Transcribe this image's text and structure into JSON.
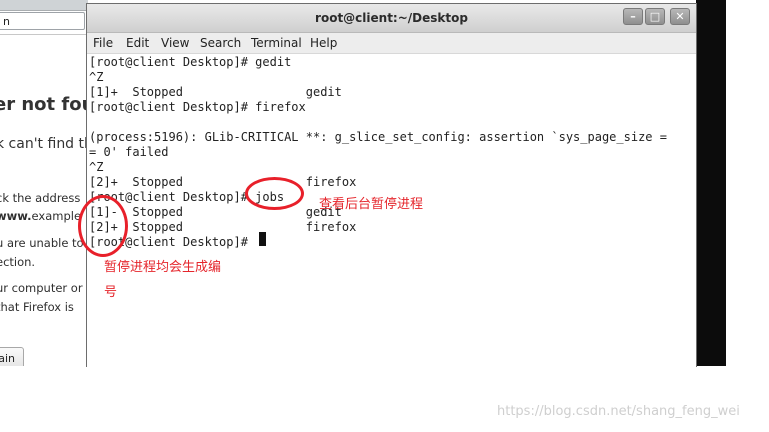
{
  "background_browser": {
    "url_partial": "n",
    "heading_partial": "er not fou",
    "subheading_partial": "k can't find th",
    "line1": "ck the address",
    "line2_prefix": "www.",
    "line2_rest": "example",
    "line3": "u are unable to",
    "line4": "ection.",
    "line5": "ur computer or",
    "line6": " that Firefox is",
    "try_button_partial": "ain"
  },
  "terminal": {
    "title": "root@client:~/Desktop",
    "window_buttons": {
      "minimize": "–",
      "maximize": "□",
      "close": "✕"
    },
    "menu": [
      "File",
      "Edit",
      "View",
      "Search",
      "Terminal",
      "Help"
    ],
    "lines": [
      "[root@client Desktop]# gedit",
      "^Z",
      "[1]+  Stopped                 gedit",
      "[root@client Desktop]# firefox",
      "",
      "(process:5196): GLib-CRITICAL **: g_slice_set_config: assertion `sys_page_size =",
      "= 0' failed",
      "^Z",
      "[2]+  Stopped                 firefox",
      "[root@client Desktop]# jobs",
      "[1]-  Stopped                 gedit",
      "[2]+  Stopped                 firefox",
      "[root@client Desktop]# "
    ]
  },
  "annotations": {
    "jobs_note": "查看后台暂停进程",
    "numbering_note_line1": "暂停进程均会生成编",
    "numbering_note_line2": "号"
  },
  "watermark": "https://blog.csdn.net/shang_feng_wei",
  "colors": {
    "annotation_red": "#e5262c",
    "terminal_bg": "#ffffff",
    "titlebar": "#dcdcdc"
  }
}
